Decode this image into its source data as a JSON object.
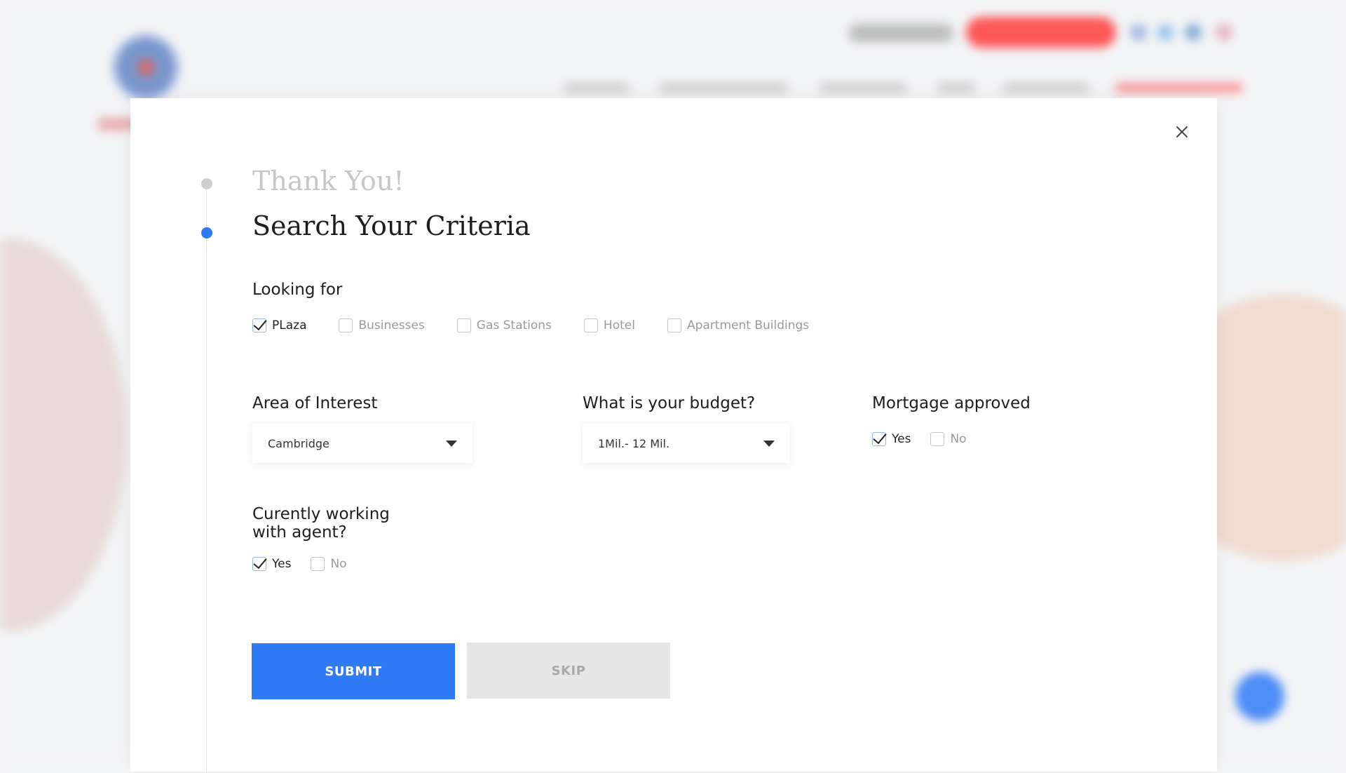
{
  "modal": {
    "close_icon": "close-icon",
    "steps": {
      "previous": "Thank You!",
      "current": "Search Your Criteria"
    },
    "looking_for": {
      "label": "Looking for",
      "options": [
        {
          "label": "PLaza",
          "checked": true
        },
        {
          "label": "Businesses",
          "checked": false
        },
        {
          "label": "Gas Stations",
          "checked": false
        },
        {
          "label": "Hotel",
          "checked": false
        },
        {
          "label": "Apartment Buildings",
          "checked": false
        }
      ]
    },
    "area": {
      "label": "Area of Interest",
      "value": "Cambridge"
    },
    "budget": {
      "label": "What is your budget?",
      "value": "1Mil.- 12 Mil."
    },
    "mortgage": {
      "label": "Mortgage approved",
      "yes": "Yes",
      "no": "No",
      "yes_checked": true,
      "no_checked": false
    },
    "agent": {
      "label_line1": "Curently working",
      "label_line2": "with agent?",
      "yes": "Yes",
      "no": "No",
      "yes_checked": true,
      "no_checked": false
    },
    "buttons": {
      "submit": "SUBMIT",
      "skip": "SKIP"
    }
  },
  "colors": {
    "accent": "#2f7bf5",
    "skip_bg": "#e6e6e6",
    "muted_text": "#9a9a9a"
  }
}
